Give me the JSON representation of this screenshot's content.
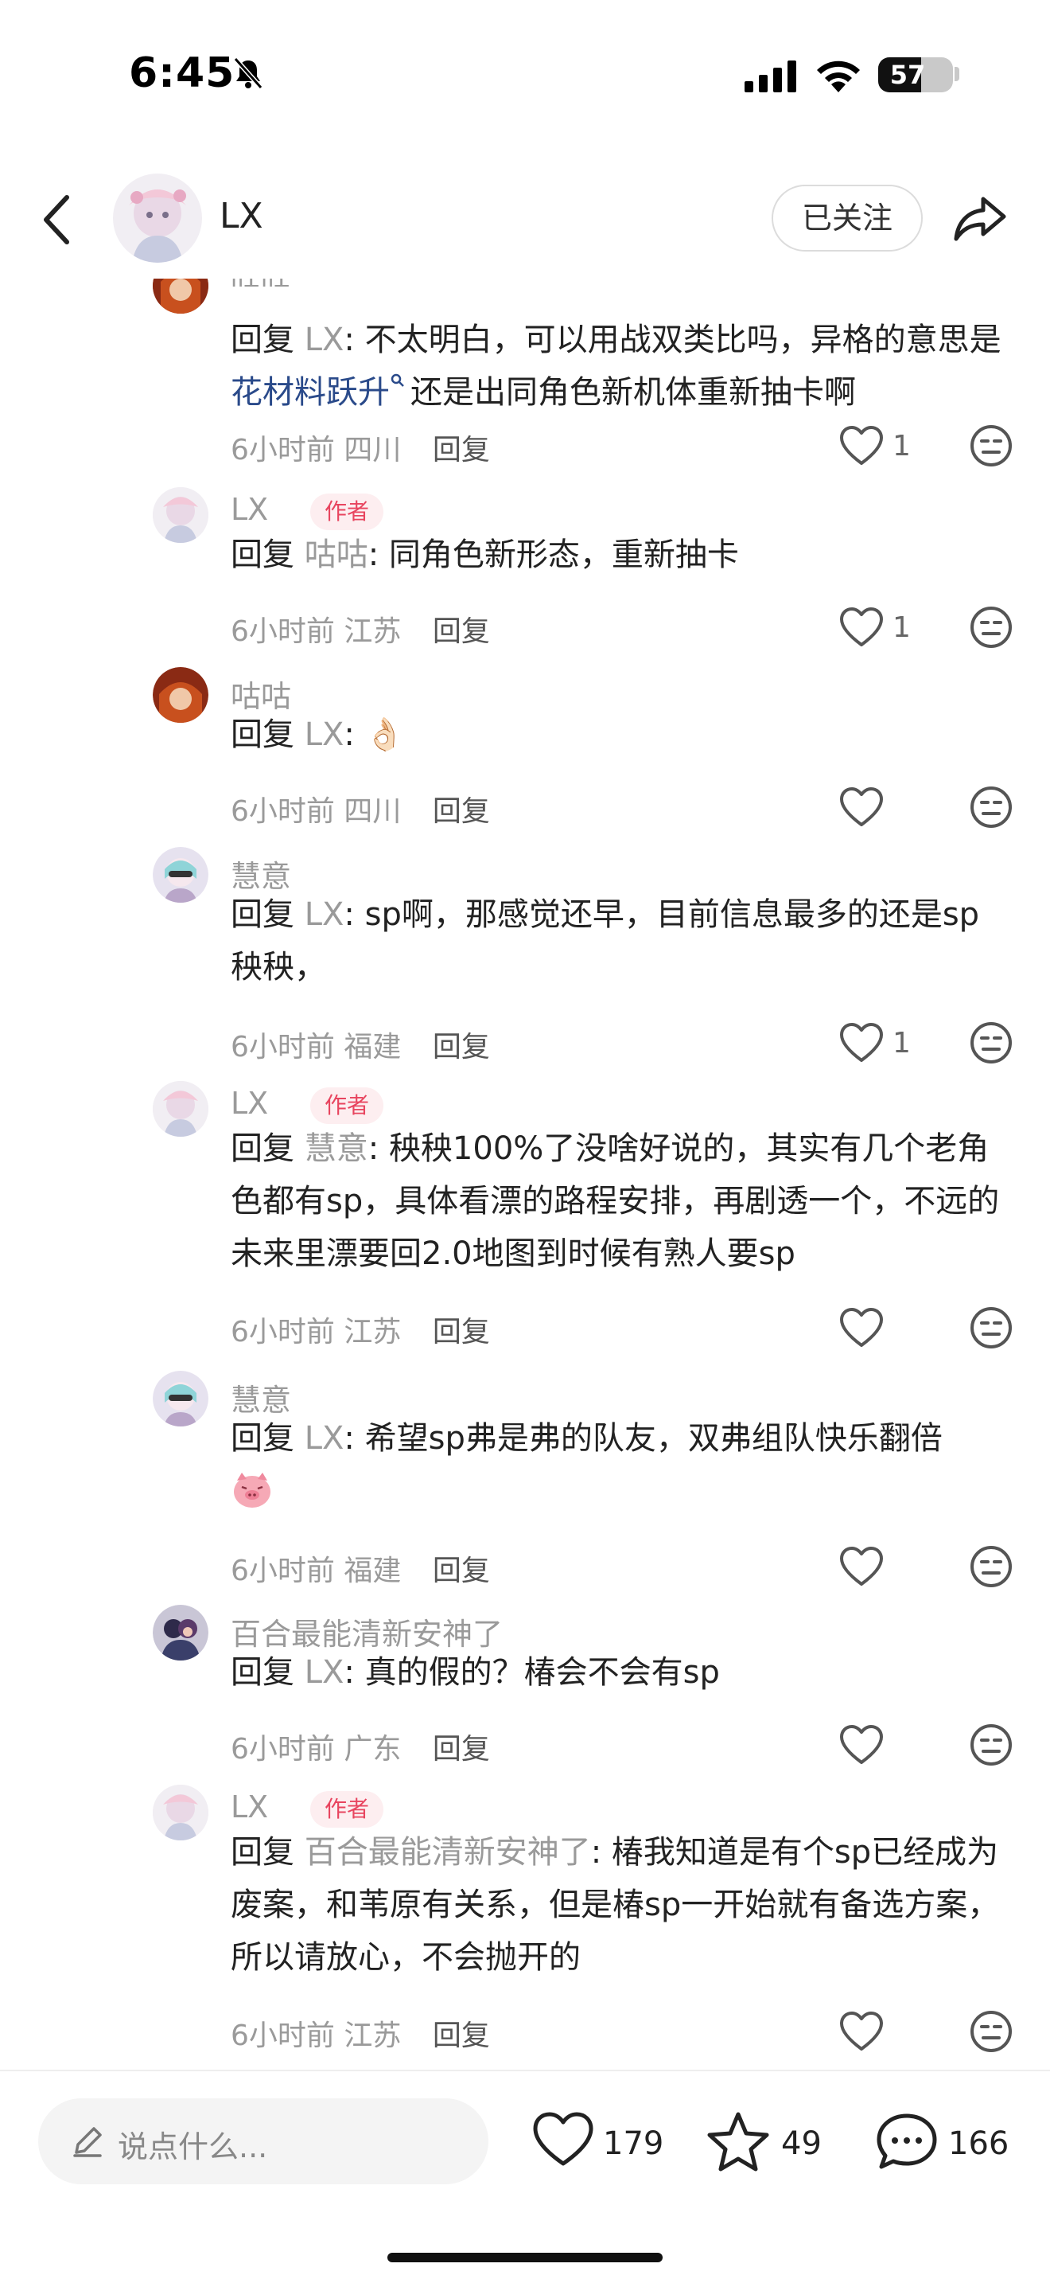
{
  "status_bar": {
    "time": "6:45",
    "battery": "57",
    "battery_level": 0.57
  },
  "header": {
    "user_name": "LX",
    "follow_label": "已关注"
  },
  "cut_comment_name": "咕咕",
  "comments": [
    {
      "reply_word": "回复",
      "target": "LX",
      "separator": ": ",
      "text_a": "不太明白，可以用战双类比吗，异格的意思是",
      "link": "花材料跃升",
      "text_b": "还是出同角色新机体重新抽卡啊",
      "time": "6小时前",
      "location": "四川",
      "reply_label": "回复",
      "likes": "1"
    },
    {
      "name": "LX",
      "badge": "作者",
      "reply_word": "回复",
      "target": "咕咕",
      "separator": ": ",
      "text": "同角色新形态，重新抽卡",
      "time": "6小时前",
      "location": "江苏",
      "reply_label": "回复",
      "likes": "1"
    },
    {
      "name": "咕咕",
      "reply_word": "回复",
      "target": "LX",
      "separator": ": ",
      "text": "👌🏻",
      "time": "6小时前",
      "location": "四川",
      "reply_label": "回复",
      "likes": ""
    },
    {
      "name": "慧意",
      "reply_word": "回复",
      "target": "LX",
      "separator": ": ",
      "text": "sp啊，那感觉还早，目前信息最多的还是sp秧秧，",
      "time": "6小时前",
      "location": "福建",
      "reply_label": "回复",
      "likes": "1"
    },
    {
      "name": "LX",
      "badge": "作者",
      "reply_word": "回复",
      "target": "慧意",
      "separator": ": ",
      "text": "秧秧100%了没啥好说的，其实有几个老角色都有sp，具体看漂的路程安排，再剧透一个，不远的未来里漂要回2.0地图到时候有熟人要sp",
      "time": "6小时前",
      "location": "江苏",
      "reply_label": "回复",
      "likes": ""
    },
    {
      "name": "慧意",
      "reply_word": "回复",
      "target": "LX",
      "separator": ": ",
      "text": "希望sp弗是弗的队友，双弗组队快乐翻倍",
      "time": "6小时前",
      "location": "福建",
      "reply_label": "回复",
      "likes": ""
    },
    {
      "name": "百合最能清新安神了",
      "reply_word": "回复",
      "target": "LX",
      "separator": ": ",
      "text": "真的假的？椿会不会有sp",
      "time": "6小时前",
      "location": "广东",
      "reply_label": "回复",
      "likes": ""
    },
    {
      "name": "LX",
      "badge": "作者",
      "reply_word": "回复",
      "target": "百合最能清新安神了",
      "separator": ": ",
      "text": "椿我知道是有个sp已经成为废案，和苇原有关系，但是椿sp一开始就有备选方案，所以请放心，不会抛开的",
      "time": "6小时前",
      "location": "江苏",
      "reply_label": "回复",
      "likes": ""
    }
  ],
  "bottom_bar": {
    "placeholder": "说点什么...",
    "likes": "179",
    "stars": "49",
    "comments": "166"
  },
  "colors": {
    "author_badge_bg": "#fdeef0",
    "author_badge_text": "#e8455f",
    "link": "#2a4a8a",
    "muted": "#9a9a9a"
  },
  "icons": [
    "bell-slash-icon",
    "signal-icon",
    "wifi-icon",
    "back-icon",
    "share-icon",
    "heart-icon",
    "neutral-face-icon",
    "pencil-icon",
    "star-icon",
    "chat-bubble-icon",
    "search-link-icon",
    "pig-emoji-icon"
  ]
}
